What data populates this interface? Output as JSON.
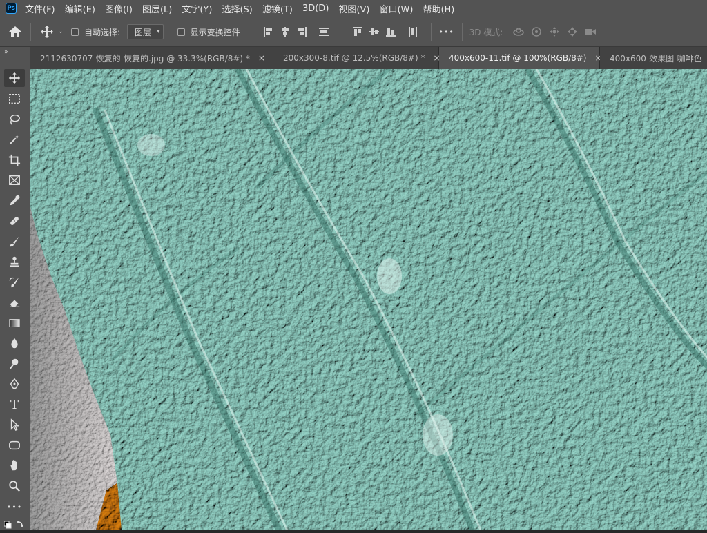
{
  "app": {
    "logo_text": "Ps"
  },
  "menu": [
    "文件(F)",
    "编辑(E)",
    "图像(I)",
    "图层(L)",
    "文字(Y)",
    "选择(S)",
    "滤镜(T)",
    "3D(D)",
    "视图(V)",
    "窗口(W)",
    "帮助(H)"
  ],
  "options": {
    "auto_select_label": "自动选择:",
    "auto_select_checked": false,
    "layer_select_value": "图层",
    "show_transform_label": "显示变换控件",
    "show_transform_checked": false,
    "more_label": "•••",
    "mode_3d_label": "3D 模式:"
  },
  "tabs": [
    {
      "label": "2112630707-恢复的-恢复的.jpg @ 33.3%(RGB/8#) *",
      "close": "×",
      "active": false
    },
    {
      "label": "200x300-8.tif @ 12.5%(RGB/8#) *",
      "close": "×",
      "active": false
    },
    {
      "label": "400x600-11.tif @ 100%(RGB/8#)",
      "close": "×",
      "active": true
    },
    {
      "label": "400x600-效果图-咖啡色",
      "close": "",
      "active": false
    }
  ],
  "toolbar": {
    "collapse_label": "››",
    "more_label": "•••",
    "tools": [
      "move-tool",
      "marquee-tool",
      "lasso-tool",
      "magic-wand-tool",
      "crop-tool",
      "frame-tool",
      "eyedropper-tool",
      "healing-brush-tool",
      "brush-tool",
      "clone-stamp-tool",
      "history-brush-tool",
      "eraser-tool",
      "gradient-tool",
      "blur-tool",
      "dodge-tool",
      "pen-tool",
      "type-tool",
      "path-selection-tool",
      "rectangle-tool",
      "hand-tool",
      "zoom-tool"
    ],
    "active_tool": "move-tool",
    "type_tool_glyph": "T"
  },
  "colors": {
    "ui_panel": "#535353",
    "ui_dark": "#282828",
    "texture_teal": "#8fc9bd",
    "texture_shadow": "#3f8276",
    "texture_highlight": "#d8f1ea",
    "leather_orange": "#c8740f"
  }
}
